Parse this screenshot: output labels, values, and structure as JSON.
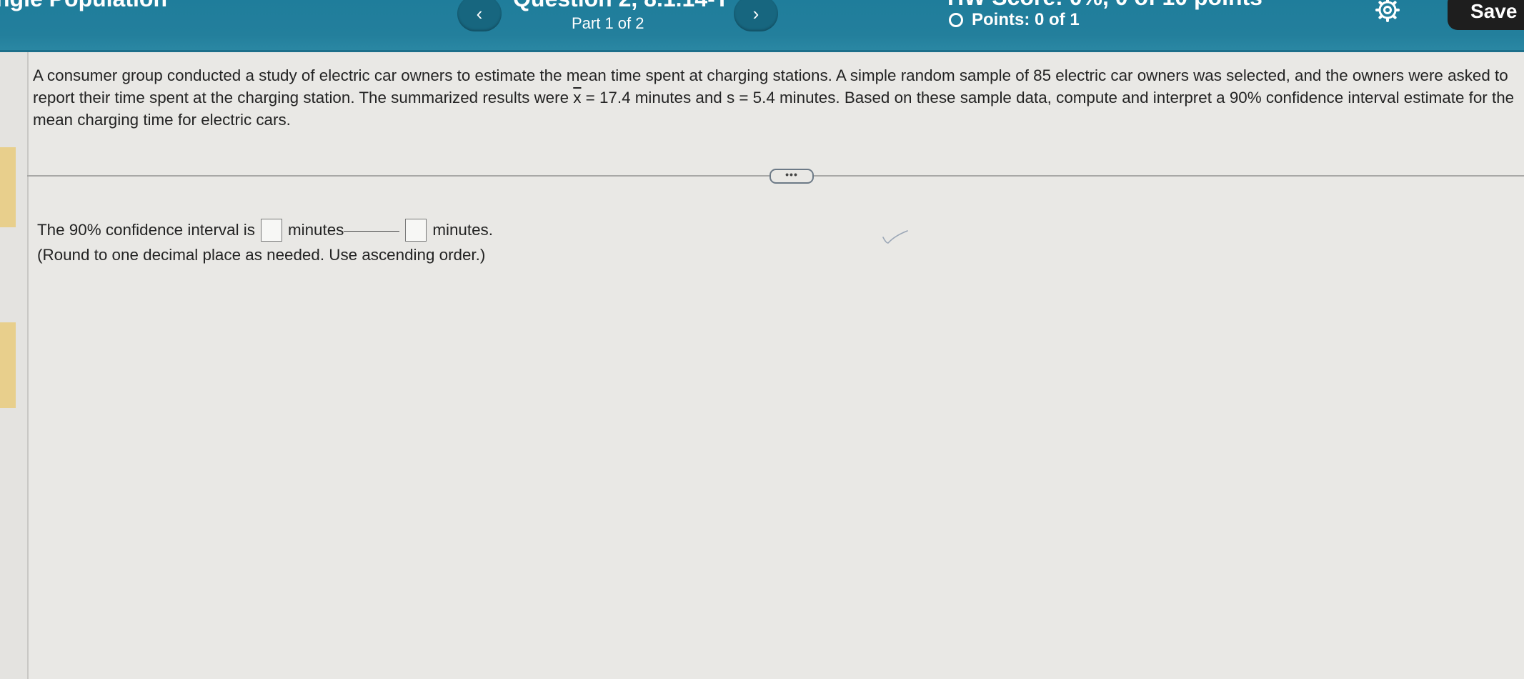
{
  "header": {
    "assignment_title": "ngle Population",
    "question_title": "Question 2, 8.1.14-T",
    "part_label": "Part 1 of 2",
    "prev_glyph": "‹",
    "next_glyph": "›",
    "hw_score": "HW Score: 0%, 0 of 10 points",
    "points": "Points: 0 of 1",
    "save_label": "Save",
    "icons": {
      "prev": "chevron-left-icon",
      "next": "chevron-right-icon",
      "points": "circle-icon",
      "settings": "gear-icon"
    }
  },
  "question": {
    "text_before_xbar": "A consumer group conducted a study of electric car owners to estimate the mean time spent at charging stations. A simple random sample of 85 electric car owners was selected, and the owners were asked to report their time spent at the charging station. The summarized results were ",
    "xbar_symbol": "x",
    "text_after_xbar": " = 17.4 minutes and s = 5.4 minutes. Based on these sample data, compute and interpret a 90% confidence interval estimate for the mean charging time for electric cars."
  },
  "divider": {
    "expand_label": "•••"
  },
  "answer": {
    "prefix": "The 90% confidence interval is",
    "unit_1": "minutes",
    "unit_2": "minutes.",
    "lower_value": "",
    "upper_value": "",
    "hint": "(Round to one decimal place as needed. Use ascending order.)"
  },
  "colors": {
    "header_bg": "#237f9c",
    "nav_button": "#17667f",
    "save_button": "#1e1e1e",
    "rail_mark": "#e8cf8c",
    "page_bg": "#e9e8e5"
  }
}
